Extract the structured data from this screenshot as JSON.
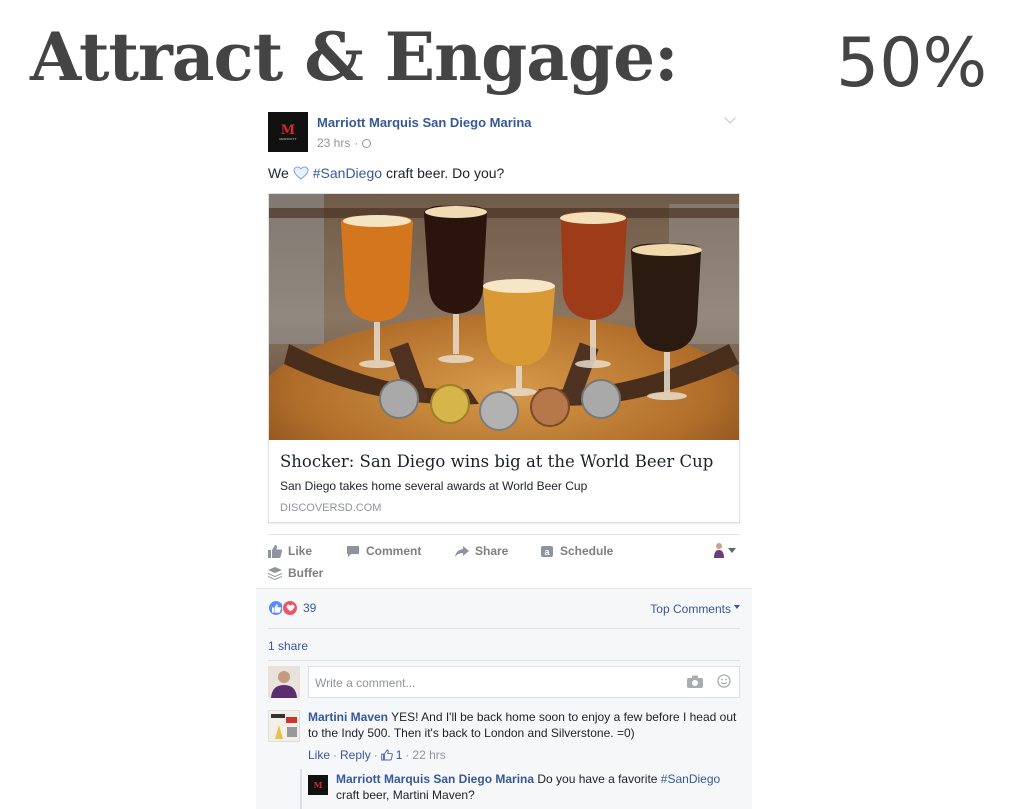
{
  "slide": {
    "title": "Attract & Engage:",
    "percent": "50%"
  },
  "post": {
    "page_name": "Marriott Marquis San Diego Marina",
    "time": "23 hrs",
    "meta_separator": "·",
    "text_before": "We",
    "hashtag": "#SanDiego",
    "text_after": "craft beer. Do you?",
    "link": {
      "title": "Shocker: San Diego wins big at the World Beer Cup",
      "description": "San Diego takes home several awards at World Beer Cup",
      "domain": "DISCOVERSD.COM"
    }
  },
  "actions": {
    "like": "Like",
    "comment": "Comment",
    "share": "Share",
    "schedule": "Schedule",
    "buffer": "Buffer"
  },
  "stats": {
    "reactions_count": "39",
    "top_comments": "Top Comments",
    "shares": "1 share"
  },
  "composer": {
    "placeholder": "Write a comment..."
  },
  "comments": [
    {
      "author": "Martini Maven",
      "text": "YES! And I'll be back home soon to enjoy a few before I head out to the Indy 500. Then it's back to London and Silverstone. =0)",
      "like_label": "Like",
      "sep1": "·",
      "reply_label": "Reply",
      "sep2": "·",
      "likes": "1",
      "sep3": "·",
      "time": "22 hrs"
    },
    {
      "author": "Marriott Marquis San Diego Marina",
      "text_before": "Do you have a favorite",
      "hashtag": "#SanDiego",
      "text_after": "craft beer, Martini Maven?"
    }
  ],
  "colors": {
    "fb_link_blue": "#365899",
    "title_gray": "#444444",
    "comments_bg": "#f6f7f9",
    "like_blue": "#5890ff",
    "love_red": "#f25268"
  },
  "icons": {
    "like": "thumbs-up-icon",
    "comment": "speech-bubble-icon",
    "share": "share-arrow-icon",
    "schedule": "buffer-a-icon",
    "buffer": "buffer-stack-icon",
    "camera": "camera-icon",
    "emoji": "smiley-icon"
  }
}
